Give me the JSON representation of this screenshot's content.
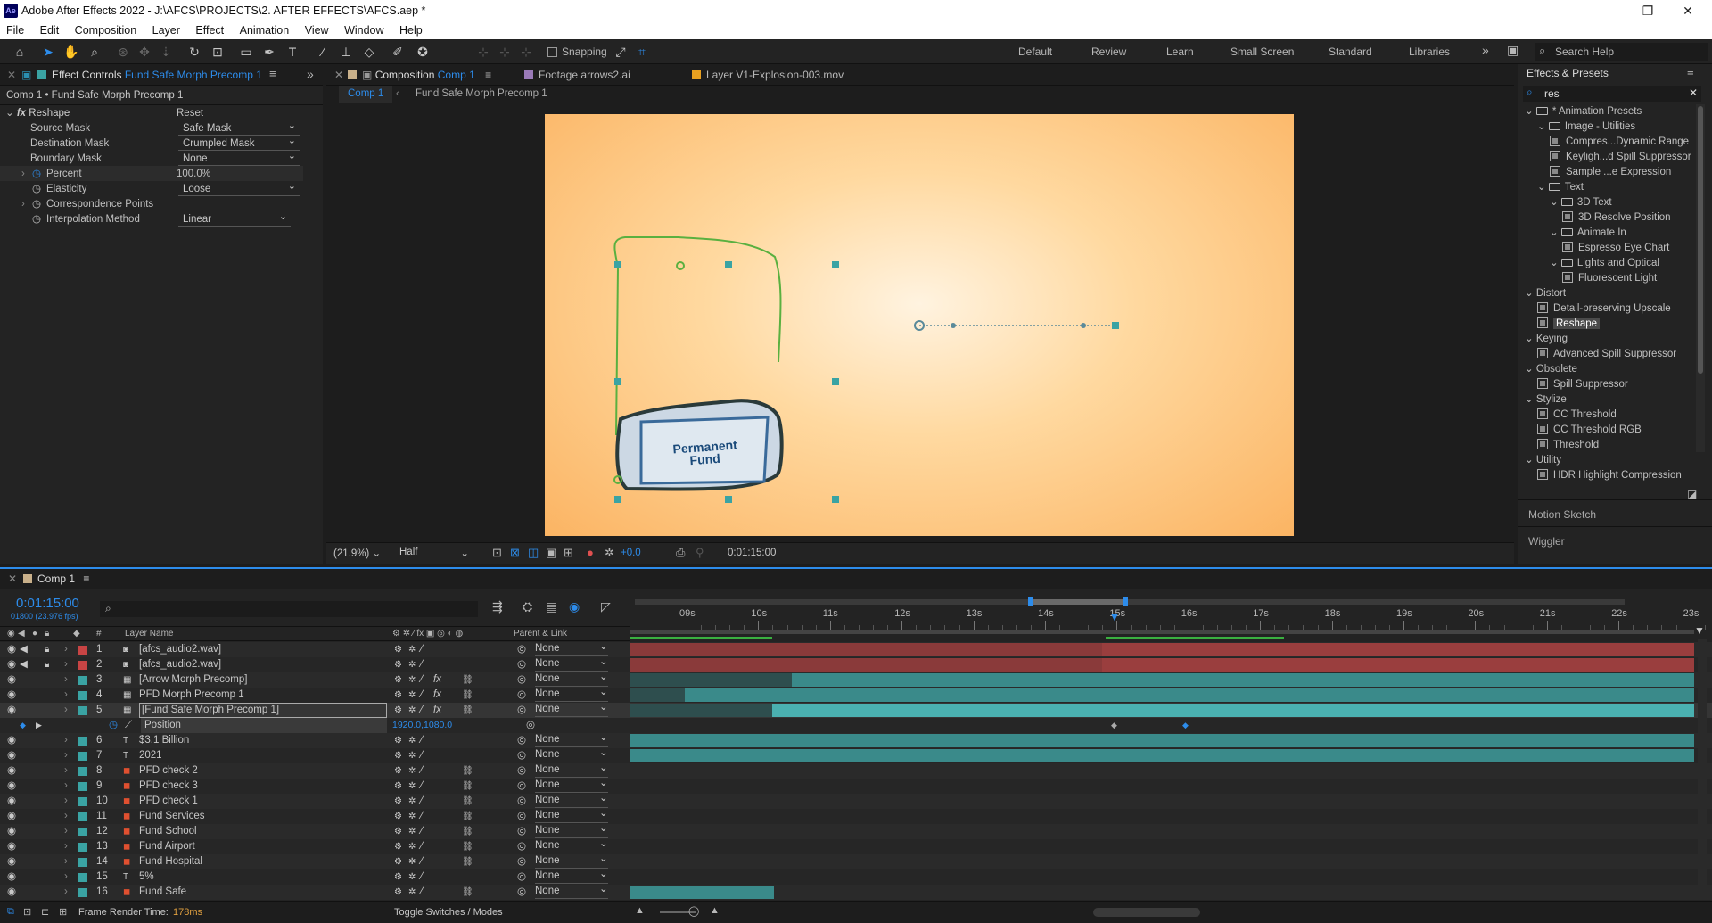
{
  "window": {
    "title": "Adobe After Effects 2022 - J:\\AFCS\\PROJECTS\\2. AFTER EFFECTS\\AFCS.aep *",
    "app_icon": "Ae",
    "controls": [
      "minimize-icon",
      "maximize-icon",
      "close-icon"
    ]
  },
  "menu": [
    "File",
    "Edit",
    "Composition",
    "Layer",
    "Effect",
    "Animation",
    "View",
    "Window",
    "Help"
  ],
  "toolbar": {
    "snapping": "Snapping",
    "workspaces": [
      "Default",
      "Review",
      "Learn",
      "Small Screen",
      "Standard",
      "Libraries"
    ],
    "search_help": "Search Help"
  },
  "effect_controls": {
    "tab_prefix": "Effect Controls",
    "tab_target": "Fund Safe Morph Precomp 1",
    "header": "Comp 1 • Fund Safe Morph Precomp 1",
    "effect": "Reshape",
    "reset": "Reset",
    "props": [
      {
        "label": "Source Mask",
        "value": "Safe Mask"
      },
      {
        "label": "Destination Mask",
        "value": "Crumpled Mask"
      },
      {
        "label": "Boundary Mask",
        "value": "None"
      },
      {
        "label": "Percent",
        "value": "100.0",
        "unit": "%"
      },
      {
        "label": "Elasticity",
        "value": "Loose"
      },
      {
        "label": "Correspondence Points",
        "value": ""
      },
      {
        "label": "Interpolation Method",
        "value": "Linear"
      }
    ]
  },
  "viewer": {
    "tabs": [
      {
        "prefix": "Composition",
        "name": "Comp 1"
      },
      {
        "prefix": "Footage",
        "name": "arrows2.ai"
      },
      {
        "prefix": "Layer",
        "name": "V1-Explosion-003.mov"
      }
    ],
    "breadcrumb": [
      "Comp 1",
      "Fund Safe Morph Precomp 1"
    ],
    "safe_text_1": "Permanent",
    "safe_text_2": "Fund",
    "zoom": "(21.9%)",
    "resolution": "Half",
    "exposure": "+0.0",
    "timecode": "0:01:15:00"
  },
  "effects_presets": {
    "title": "Effects & Presets",
    "search": "res",
    "items": [
      {
        "level": 0,
        "type": "folder",
        "label": "* Animation Presets"
      },
      {
        "level": 1,
        "type": "folder",
        "label": "Image - Utilities"
      },
      {
        "level": 2,
        "type": "preset",
        "label": "Compres...Dynamic Range"
      },
      {
        "level": 2,
        "type": "preset",
        "label": "Keyligh...d Spill Suppressor"
      },
      {
        "level": 2,
        "type": "preset",
        "label": "Sample ...e Expression"
      },
      {
        "level": 1,
        "type": "folder",
        "label": "Text"
      },
      {
        "level": 2,
        "type": "folder",
        "label": "3D Text"
      },
      {
        "level": 3,
        "type": "preset",
        "label": "3D Resolve Position"
      },
      {
        "level": 2,
        "type": "folder",
        "label": "Animate In"
      },
      {
        "level": 3,
        "type": "preset",
        "label": "Espresso Eye Chart"
      },
      {
        "level": 2,
        "type": "folder",
        "label": "Lights and Optical"
      },
      {
        "level": 3,
        "type": "preset",
        "label": "Fluorescent Light"
      },
      {
        "level": 0,
        "type": "category",
        "label": "Distort"
      },
      {
        "level": 1,
        "type": "preset",
        "label": "Detail-preserving Upscale"
      },
      {
        "level": 1,
        "type": "preset",
        "label": "Reshape",
        "selected": true
      },
      {
        "level": 0,
        "type": "category",
        "label": "Keying"
      },
      {
        "level": 1,
        "type": "preset",
        "label": "Advanced Spill Suppressor"
      },
      {
        "level": 0,
        "type": "category",
        "label": "Obsolete"
      },
      {
        "level": 1,
        "type": "preset",
        "label": "Spill Suppressor"
      },
      {
        "level": 0,
        "type": "category",
        "label": "Stylize"
      },
      {
        "level": 1,
        "type": "preset",
        "label": "CC Threshold"
      },
      {
        "level": 1,
        "type": "preset",
        "label": "CC Threshold RGB"
      },
      {
        "level": 1,
        "type": "preset",
        "label": "Threshold"
      },
      {
        "level": 0,
        "type": "category",
        "label": "Utility"
      },
      {
        "level": 1,
        "type": "preset",
        "label": "HDR Highlight Compression"
      }
    ],
    "panels": [
      "Motion Sketch",
      "Wiggler"
    ]
  },
  "timeline": {
    "tab": "Comp 1",
    "timecode": "0:01:15:00",
    "frames": "01800 (23.976 fps)",
    "layer_name_header": "Layer Name",
    "parent_header": "Parent & Link",
    "num_header": "#",
    "ruler": [
      "09s",
      "10s",
      "11s",
      "12s",
      "13s",
      "14s",
      "15s",
      "16s",
      "17s",
      "18s",
      "19s",
      "20s",
      "21s",
      "22s",
      "23s"
    ],
    "layers": [
      {
        "num": "1",
        "name": "[afcs_audio2.wav]",
        "type": "audio",
        "color": "#c84444",
        "parent": "None"
      },
      {
        "num": "2",
        "name": "[afcs_audio2.wav]",
        "type": "audio",
        "color": "#c84444",
        "parent": "None"
      },
      {
        "num": "3",
        "name": "[Arrow Morph Precomp]",
        "type": "precomp",
        "color": "#3aa3a3",
        "parent": "None"
      },
      {
        "num": "4",
        "name": "PFD Morph Precomp 1",
        "type": "precomp",
        "color": "#3aa3a3",
        "parent": "None"
      },
      {
        "num": "5",
        "name": "[Fund Safe Morph Precomp 1]",
        "type": "precomp",
        "color": "#3aa3a3",
        "parent": "None",
        "selected": true
      },
      {
        "num": "",
        "name": "Position",
        "type": "property",
        "value": "1920.0,1080.0"
      },
      {
        "num": "6",
        "name": "$3.1 Billion",
        "type": "text",
        "color": "#3aa3a3",
        "parent": "None"
      },
      {
        "num": "7",
        "name": "2021",
        "type": "text",
        "color": "#3aa3a3",
        "parent": "None"
      },
      {
        "num": "8",
        "name": "PFD check 2",
        "type": "ai",
        "color": "#3aa3a3",
        "parent": "None"
      },
      {
        "num": "9",
        "name": "PFD check 3",
        "type": "ai",
        "color": "#3aa3a3",
        "parent": "None"
      },
      {
        "num": "10",
        "name": "PFD check 1",
        "type": "ai",
        "color": "#3aa3a3",
        "parent": "None"
      },
      {
        "num": "11",
        "name": "Fund Services",
        "type": "ai",
        "color": "#3aa3a3",
        "parent": "None"
      },
      {
        "num": "12",
        "name": "Fund School",
        "type": "ai",
        "color": "#3aa3a3",
        "parent": "None"
      },
      {
        "num": "13",
        "name": "Fund Airport",
        "type": "ai",
        "color": "#3aa3a3",
        "parent": "None"
      },
      {
        "num": "14",
        "name": "Fund Hospital",
        "type": "ai",
        "color": "#3aa3a3",
        "parent": "None"
      },
      {
        "num": "15",
        "name": "5%",
        "type": "text",
        "color": "#3aa3a3",
        "parent": "None"
      },
      {
        "num": "16",
        "name": "Fund Safe",
        "type": "ai",
        "color": "#3aa3a3",
        "parent": "None"
      }
    ],
    "footer": {
      "render_label": "Frame Render Time:",
      "render_value": "178ms",
      "toggle": "Toggle Switches / Modes"
    }
  }
}
